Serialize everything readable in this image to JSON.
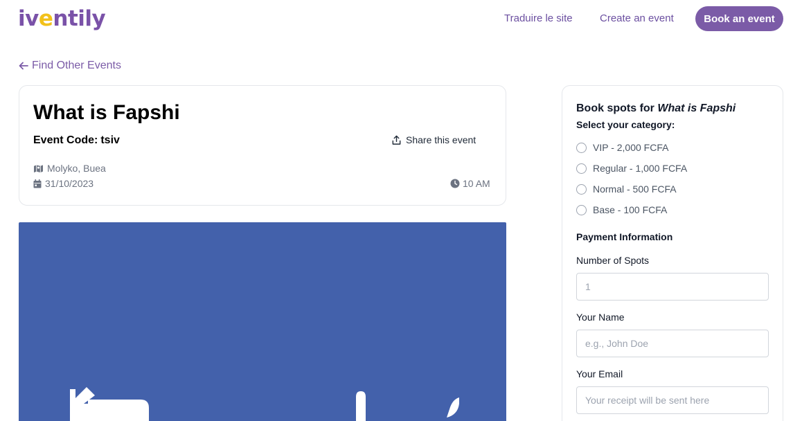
{
  "header": {
    "logo": {
      "prefix": "iv",
      "accent": "e",
      "suffix": "ntily"
    },
    "nav": {
      "translate": "Traduire le site",
      "create": "Create an event",
      "book": "Book an event"
    }
  },
  "back_link": "Find Other Events",
  "event": {
    "title": "What is Fapshi",
    "code_label": "Event Code:",
    "code": "tsiv",
    "share": "Share this event",
    "location": "Molyko, Buea",
    "date": "31/10/2023",
    "time": "10 AM"
  },
  "booking": {
    "title_prefix": "Book spots for",
    "event_name": "What is Fapshi",
    "select_category": "Select your category:",
    "categories": [
      "VIP - 2,000 FCFA",
      "Regular - 1,000 FCFA",
      "Normal - 500 FCFA",
      "Base - 100 FCFA"
    ],
    "payment_heading": "Payment Information",
    "spots_label": "Number of Spots",
    "spots_placeholder": "1",
    "name_label": "Your Name",
    "name_placeholder": "e.g., John Doe",
    "email_label": "Your Email",
    "email_placeholder": "Your receipt will be sent here"
  },
  "colors": {
    "brand": "#7b5ba7",
    "accent": "#f2c11a",
    "image_bg": "#4361ab"
  }
}
